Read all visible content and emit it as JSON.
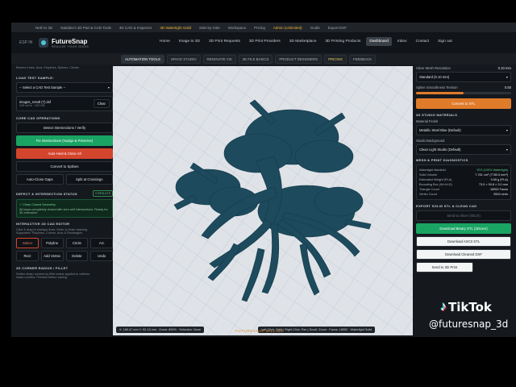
{
  "browser_tabs": [
    "Netf ex 3D",
    "Nataliex's 3D Part & CAD Tools",
    "3D CAD & Inspector",
    "3D Watertight Solid",
    "Side-by-Side",
    "Workspace",
    "Pricing",
    "Admin (Unlimited)",
    "Guide",
    "Export DXF"
  ],
  "nav": {
    "language": "ESP IN",
    "brand": "FutureSnap",
    "tagline": "REALIZE YOUR IDEAS",
    "links": [
      "Home",
      "Image to 3D",
      "3D Print Requests",
      "3D Print Providers",
      "3D Marketplace",
      "3D Printing Products",
      "Dashboard",
      "Inbox",
      "Contact",
      "Sign out"
    ],
    "active_link": "Dashboard",
    "export_label": "Export DXF"
  },
  "subnav": {
    "tabs": [
      "AUTOMATION TOOLS",
      "SPACE STUDIO",
      "RENOVATE VIS",
      "3D FILE BASICS",
      "PRODUCT DESIGNERS",
      "PRICING",
      "FEEDBACK"
    ],
    "active": "AUTOMATION TOOLS",
    "accent": "PRICING"
  },
  "left": {
    "intro": "Beziers Lines, Arcs, Polylines, Splines, Circles",
    "load_test_sample": "LOAD TEST SAMPLE:",
    "sample_select": "-- Select a CAD Test Sample --",
    "file_name": "images_result (7).dxf",
    "file_meta": "245 verts · 102 KB",
    "clear": "Clear",
    "core_ops": "CORE CAD OPERATIONS",
    "detect": "Detect Intersections / Verify",
    "fix": "Fix Intersections (Nudge & Preserve)",
    "autoheal": "Auto-Heal & Close All",
    "convert": "Convert to Splines",
    "auto_close": "Auto-Close Gaps",
    "split": "Split at Crossings",
    "defect_status": "DEFECT & INTERSECTION STATUS",
    "status_badge": "0 RESULTS",
    "status_title": "✓ Clean Closed Geometry",
    "status_desc": "All loops completely closed with zero self intersections. Ready for 3D extrusion!",
    "editor": "INTERACTIVE 2D CAD EDITOR",
    "editor_desc": "Click & drag to reshape lines. Enter to finish drawing.",
    "editor_desc2": "Supported: Polylines, Curves, Arcs & Rectangles.",
    "tools": [
      "Select",
      "Polyline",
      "Circle",
      "Arc"
    ],
    "tools2": [
      "Rect",
      "Add Vertex",
      "Delete",
      "Undo"
    ],
    "corner": "2D CORNER RADIUS / FILLET",
    "corner_desc": "Soften sharp corners by fillet radius applied to outlines",
    "corner_desc2": "sharp corners. Preview before saving."
  },
  "viewport": {
    "status": "X: 189.47 mm  Y: 52.13 mm  ·  Zoom: 859%  ·  Selection: None",
    "hint": "Left-Click: Orbit | Right-Click: Pan | Scroll: Zoom  ·  Faces: 18952  ·  Watertight Solid"
  },
  "right": {
    "mesh_res_label": "Slicer Mesh Resolution",
    "mesh_res_value": "0.10 mm",
    "mesh_select": "Standard (0.10 mm)",
    "smooth_label": "Spline Smoothness Tension",
    "smooth_value": "0.50",
    "smooth_fraction": 0.5,
    "convert_stl": "Convert to STL",
    "materials": "3D STUDIO MATERIALS",
    "finish_label": "Material Finish",
    "finish_value": "Metallic Steel Blue (Default)",
    "bg_label": "Studio Background",
    "bg_value": "Clean Light Studio (Default)",
    "diag": "MESH & PRINT DIAGNOSTICS",
    "stats": [
      {
        "k": "Watertight Manifold",
        "v": "YES (100% Watertight)",
        "good": true
      },
      {
        "k": "Solid Volume",
        "v": "7.781 cm³ (7780.9 mm³)"
      },
      {
        "k": "Estimated Weight (PLA)",
        "v": "9.65 g (PLA)"
      },
      {
        "k": "Bounding Box (W×H×D)",
        "v": "73.0 × 90.8 × 3.0 mm"
      },
      {
        "k": "Triangle Count",
        "v": "18952 Faces"
      },
      {
        "k": "Vertex Count",
        "v": "9504 verts"
      }
    ],
    "export": "EXPORT SOLID STL & CLEAN CAD",
    "send": "Send to Slicer (Slic3r)",
    "download_stl": "Download Binary STL (3Dcore)",
    "download_ascii": "Download ASCII STL",
    "download_dxf": "Download Cleaned DXF",
    "send_app": "Send to 3D Print"
  },
  "footer": {
    "billing": "FUTURESNAP BILLING"
  },
  "overlay": {
    "brand": "TikTok",
    "handle": "@futuresnap_3d"
  },
  "colors": {
    "accent_green": "#1aa463",
    "accent_red": "#d4452e",
    "accent_orange": "#e07b2a",
    "model_blue": "#1d4a5c"
  }
}
